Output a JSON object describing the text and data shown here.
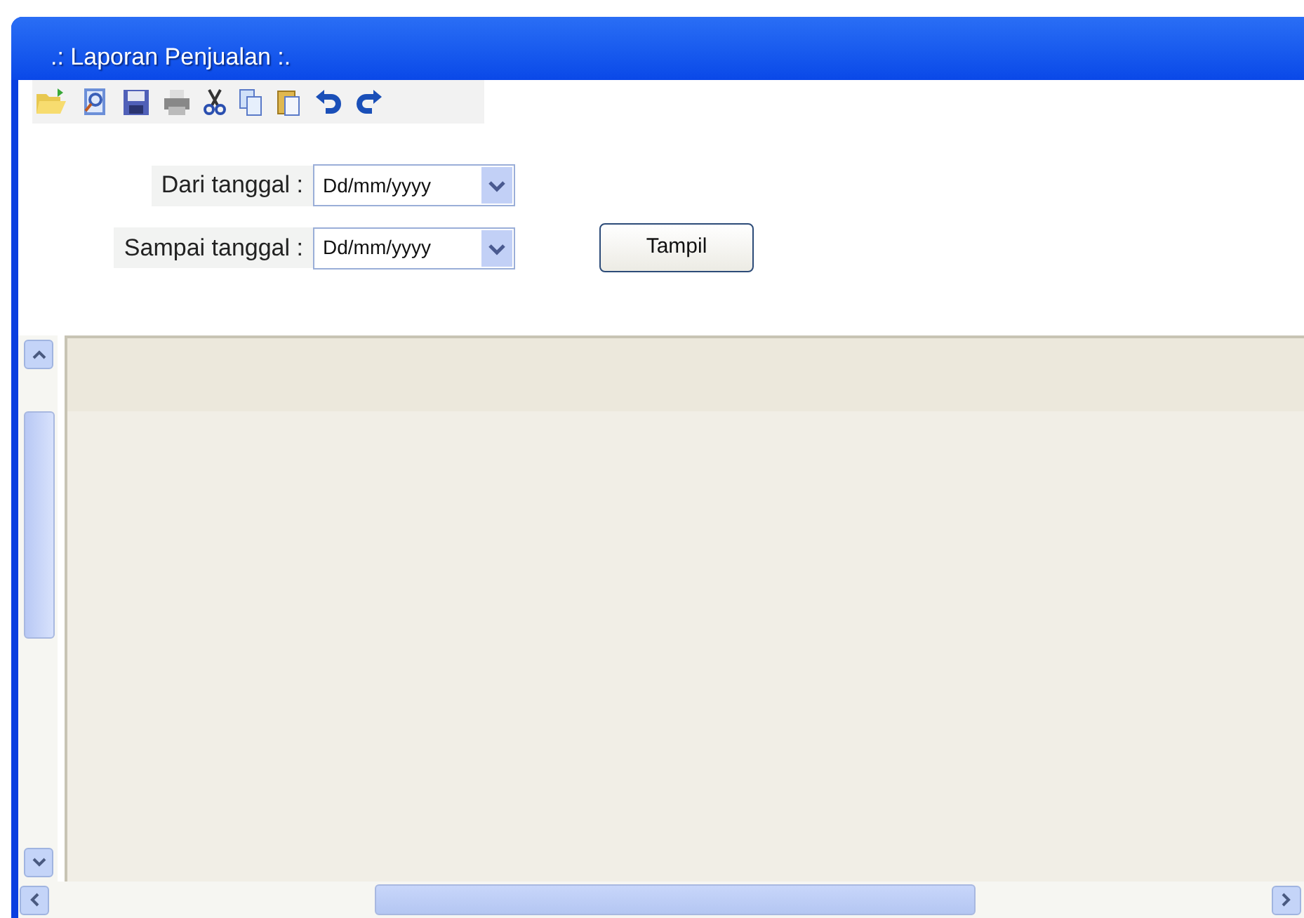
{
  "window": {
    "title": ".: Laporan Penjualan :."
  },
  "fields": [
    {
      "label": "Dari tanggal :",
      "value": "Dd/mm/yyyy"
    },
    {
      "label": "Sampai tanggal :",
      "value": "Dd/mm/yyyy"
    }
  ],
  "buttons": [
    "Tampil"
  ]
}
